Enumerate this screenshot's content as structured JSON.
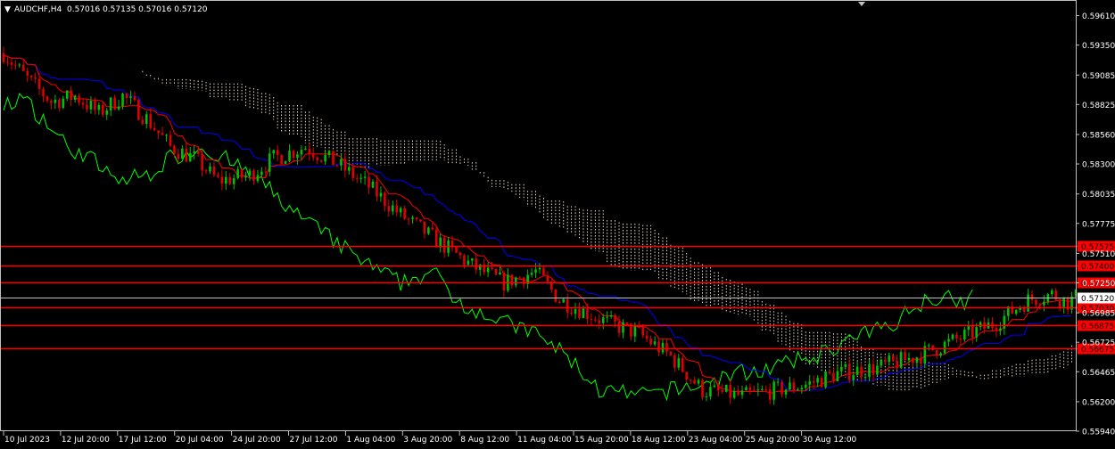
{
  "header": {
    "symbol": "AUDCHF,H4",
    "ohlc": "0.57016 0.57135 0.57016 0.57120"
  },
  "colors": {
    "background": "#000000",
    "frame": "#c0c0c0",
    "text": "#ffffff",
    "bull_candle": "#00c000",
    "bear_candle": "#e00000",
    "tenkan": "#ff0000",
    "kijun": "#0000ff",
    "chikou": "#00ff00",
    "cloud": "#fff0e0",
    "level_line": "#ff0000",
    "current_price_line": "#c0c0c0"
  },
  "chart_data": {
    "type": "candlestick",
    "indicator": "ichimoku",
    "ylim": [
      0.5594,
      0.5974
    ],
    "price_ticks": [
      "0.59610",
      "0.59350",
      "0.59085",
      "0.58825",
      "0.58560",
      "0.58300",
      "0.58035",
      "0.57775",
      "0.57510",
      "0.57250",
      "0.56985",
      "0.56725",
      "0.56465",
      "0.56200",
      "0.55940"
    ],
    "time_ticks": [
      "10 Jul 2023",
      "12 Jul 20:00",
      "17 Jul 12:00",
      "20 Jul 04:00",
      "24 Jul 20:00",
      "27 Jul 12:00",
      "1 Aug 04:00",
      "3 Aug 20:00",
      "8 Aug 12:00",
      "11 Aug 04:00",
      "15 Aug 20:00",
      "18 Aug 12:00",
      "23 Aug 04:00",
      "25 Aug 20:00",
      "30 Aug 12:00"
    ],
    "current_price": "0.57120",
    "levels": [
      {
        "price": 0.57575,
        "label": "0.57575"
      },
      {
        "price": 0.574,
        "label": "0.57400"
      },
      {
        "price": 0.5725,
        "label": "0.57250"
      },
      {
        "price": 0.5703,
        "label": "0.57030"
      },
      {
        "price": 0.56875,
        "label": "0.56875"
      },
      {
        "price": 0.56675,
        "label": "0.56675"
      }
    ],
    "close_path": [
      [
        0,
        0.5928
      ],
      [
        6,
        0.5905
      ],
      [
        12,
        0.5885
      ],
      [
        18,
        0.589
      ],
      [
        24,
        0.5875
      ],
      [
        30,
        0.589
      ],
      [
        36,
        0.587
      ],
      [
        42,
        0.5845
      ],
      [
        48,
        0.5835
      ],
      [
        54,
        0.5815
      ],
      [
        62,
        0.582
      ],
      [
        68,
        0.5835
      ],
      [
        76,
        0.5845
      ],
      [
        84,
        0.583
      ],
      [
        92,
        0.581
      ],
      [
        100,
        0.5785
      ],
      [
        110,
        0.576
      ],
      [
        118,
        0.574
      ],
      [
        126,
        0.5725
      ],
      [
        134,
        0.5735
      ],
      [
        140,
        0.571
      ],
      [
        146,
        0.57
      ],
      [
        152,
        0.569
      ],
      [
        160,
        0.568
      ],
      [
        168,
        0.566
      ],
      [
        176,
        0.563
      ],
      [
        186,
        0.5625
      ],
      [
        194,
        0.563
      ],
      [
        202,
        0.5635
      ],
      [
        210,
        0.5645
      ],
      [
        220,
        0.565
      ],
      [
        230,
        0.566
      ],
      [
        240,
        0.5675
      ],
      [
        250,
        0.569
      ],
      [
        258,
        0.571
      ],
      [
        264,
        0.5715
      ],
      [
        268,
        0.5708
      ],
      [
        270,
        0.5712
      ]
    ],
    "cloud": {
      "a": [],
      "b": []
    },
    "tenkan": [],
    "kijun": [],
    "chikou": []
  }
}
